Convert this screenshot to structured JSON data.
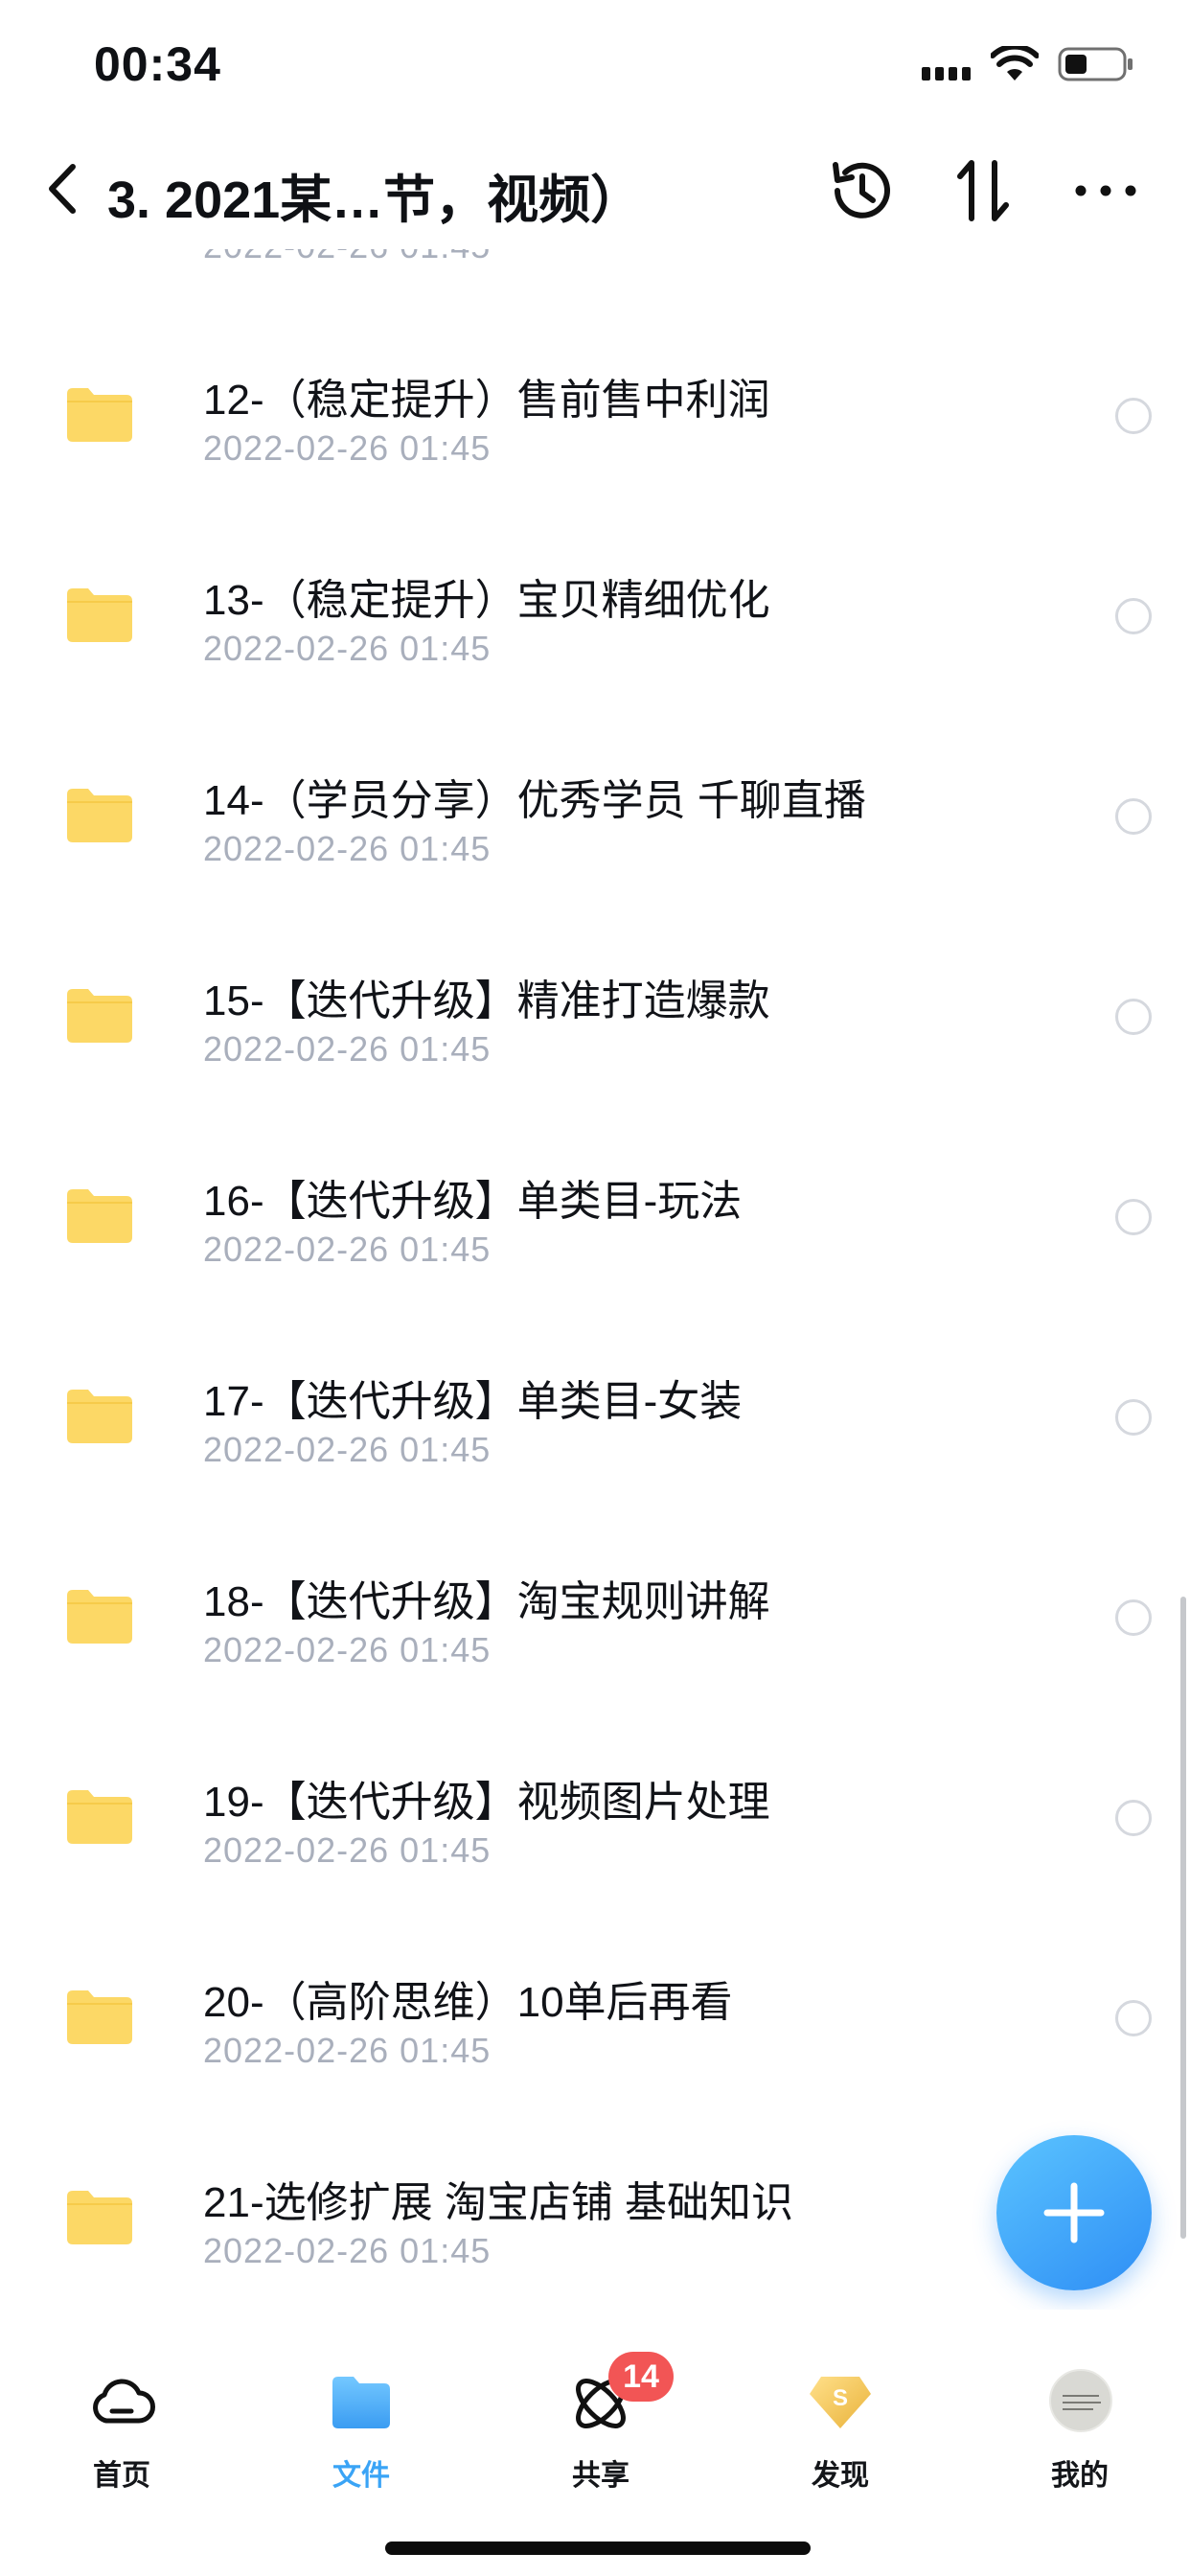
{
  "status_bar": {
    "time": "00:34"
  },
  "nav": {
    "title": "3. 2021某…节，视频）"
  },
  "list": {
    "partial_date": "2022-02-26 01:45",
    "items": [
      {
        "name": "12-（稳定提升）售前售中利润",
        "date": "2022-02-26 01:45"
      },
      {
        "name": "13-（稳定提升）宝贝精细优化",
        "date": "2022-02-26 01:45"
      },
      {
        "name": "14-（学员分享）优秀学员 千聊直播",
        "date": "2022-02-26 01:45"
      },
      {
        "name": "15-【迭代升级】精准打造爆款",
        "date": "2022-02-26 01:45"
      },
      {
        "name": "16-【迭代升级】单类目-玩法",
        "date": "2022-02-26 01:45"
      },
      {
        "name": "17-【迭代升级】单类目-女装",
        "date": "2022-02-26 01:45"
      },
      {
        "name": "18-【迭代升级】淘宝规则讲解",
        "date": "2022-02-26 01:45"
      },
      {
        "name": "19-【迭代升级】视频图片处理",
        "date": "2022-02-26 01:45"
      },
      {
        "name": "20-（高阶思维）10单后再看",
        "date": "2022-02-26 01:45"
      },
      {
        "name": "21-选修扩展 淘宝店铺 基础知识",
        "date": "2022-02-26 01:45"
      }
    ]
  },
  "tabs": [
    {
      "label": "首页",
      "icon": "cloud-icon"
    },
    {
      "label": "文件",
      "icon": "folder-icon",
      "active": true
    },
    {
      "label": "共享",
      "icon": "share-icon",
      "badge": "14"
    },
    {
      "label": "发现",
      "icon": "discover-icon"
    },
    {
      "label": "我的",
      "icon": "avatar"
    }
  ],
  "colors": {
    "accent": "#3aa4f6",
    "folder": "#fcd866",
    "badge": "#f25555",
    "date": "#a9afbc"
  }
}
